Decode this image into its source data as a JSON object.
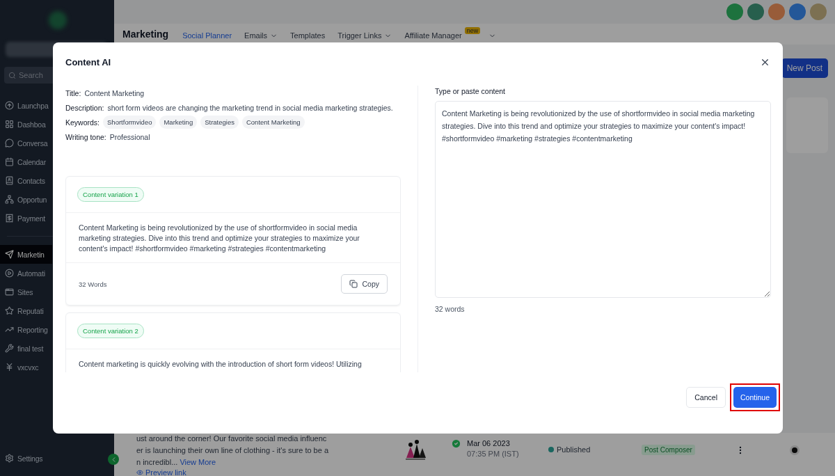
{
  "sidebar": {
    "search": {
      "placeholder": "Search"
    },
    "items": [
      {
        "label": "Launchpa",
        "selected": false
      },
      {
        "label": "Dashboa",
        "selected": false
      },
      {
        "label": "Conversa",
        "selected": false
      },
      {
        "label": "Calendar",
        "selected": false
      },
      {
        "label": "Contacts",
        "selected": false
      },
      {
        "label": "Opportun",
        "selected": false
      },
      {
        "label": "Payment",
        "selected": false
      },
      {
        "label": "Marketin",
        "selected": true
      },
      {
        "label": "Automati",
        "selected": false
      },
      {
        "label": "Sites",
        "selected": false
      },
      {
        "label": "Reputati",
        "selected": false
      },
      {
        "label": "Reporting",
        "selected": false
      },
      {
        "label": "final test",
        "selected": false
      },
      {
        "label": "vxcvxc",
        "selected": false
      }
    ],
    "settings": "Settings"
  },
  "header": {
    "title": "Marketing",
    "nav": [
      {
        "label": "Social Planner",
        "selected": true,
        "dropdown": false
      },
      {
        "label": "Emails",
        "selected": false,
        "dropdown": true
      },
      {
        "label": "Templates",
        "selected": false,
        "dropdown": false
      },
      {
        "label": "Trigger Links",
        "selected": false,
        "dropdown": true
      },
      {
        "label": "Affiliate Manager",
        "selected": false,
        "dropdown": true,
        "badge": "new"
      }
    ]
  },
  "new_post_button": "New Post",
  "post": {
    "text_lines": [
      "ust around the corner! Our favorite social media influenc",
      "er is launching their own line of clothing - it's sure to be a",
      "n incredibl..."
    ],
    "view_more": "View More",
    "preview_link": "Preview link",
    "date": "Mar 06 2023",
    "time": "07:35 PM (IST)",
    "status": "Published",
    "source": "Post Composer"
  },
  "modal": {
    "title": "Content AI",
    "details": [
      {
        "kind": "text",
        "label": "Title:",
        "value": "Content Marketing"
      },
      {
        "kind": "text",
        "label": "Description:",
        "value": "short form videos are changing the marketing trend in social media marketing strategies."
      },
      {
        "kind": "chips",
        "label": "Keywords:",
        "chips": [
          "Shortformvideo",
          "Marketing",
          "Strategies",
          "Content Marketing"
        ]
      },
      {
        "kind": "text",
        "label": "Writing tone:",
        "value": "Professional"
      }
    ],
    "variations": [
      {
        "tag": "Content variation 1",
        "text": "Content Marketing is being revolutionized by the use of shortformvideo in social media marketing strategies. Dive into this trend and optimize your strategies to maximize your content's impact! #shortformvideo #marketing #strategies #contentmarketing",
        "word_count": "32 Words",
        "copy_button": "Copy"
      },
      {
        "tag": "Content variation 2",
        "text": "Content marketing is quickly evolving with the introduction of short form videos! Utilizing"
      }
    ],
    "editor": {
      "label": "Type or paste content",
      "value": "Content Marketing is being revolutionized by the use of shortformvideo in social media marketing strategies. Dive into this trend and optimize your strategies to maximize your content's impact! #shortformvideo #marketing #strategies #contentmarketing",
      "word_count": "32 words"
    },
    "cancel_button": "Cancel",
    "continue_button": {
      "label": "Continue",
      "highlighted": true
    }
  }
}
